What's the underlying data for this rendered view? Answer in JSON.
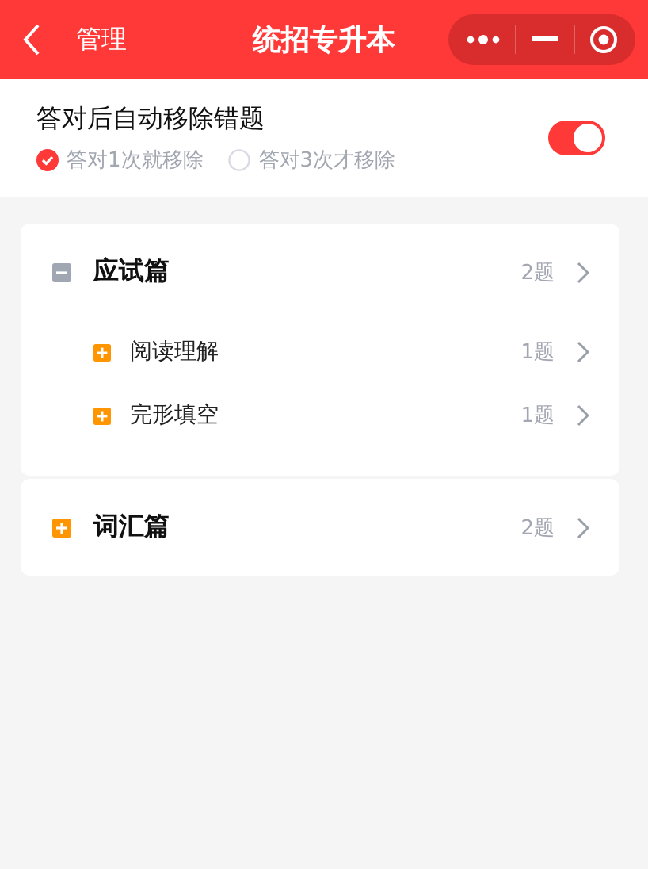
{
  "nav_bar": {
    "back_label": "管理",
    "title": "统招专升本"
  },
  "settings": {
    "label": "答对后自动移除错题",
    "on": true,
    "options": [
      {
        "label": "答对1次就移除",
        "selected": true
      },
      {
        "label": "答对3次才移除",
        "selected": false
      }
    ]
  },
  "sections": [
    {
      "title": "应试篇",
      "count": "2题",
      "expanded": true,
      "children": [
        {
          "title": "阅读理解",
          "count": "1题",
          "expanded": false
        },
        {
          "title": "完形填空",
          "count": "1题",
          "expanded": false
        }
      ]
    },
    {
      "title": "词汇篇",
      "count": "2题",
      "expanded": false
    }
  ]
}
